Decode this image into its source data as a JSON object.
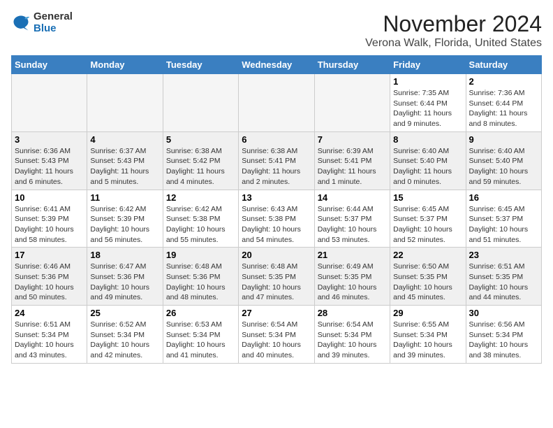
{
  "header": {
    "logo_general": "General",
    "logo_blue": "Blue",
    "month_title": "November 2024",
    "location": "Verona Walk, Florida, United States"
  },
  "weekdays": [
    "Sunday",
    "Monday",
    "Tuesday",
    "Wednesday",
    "Thursday",
    "Friday",
    "Saturday"
  ],
  "weeks": [
    [
      {
        "day": "",
        "info": "",
        "empty": true
      },
      {
        "day": "",
        "info": "",
        "empty": true
      },
      {
        "day": "",
        "info": "",
        "empty": true
      },
      {
        "day": "",
        "info": "",
        "empty": true
      },
      {
        "day": "",
        "info": "",
        "empty": true
      },
      {
        "day": "1",
        "info": "Sunrise: 7:35 AM\nSunset: 6:44 PM\nDaylight: 11 hours\nand 9 minutes.",
        "empty": false
      },
      {
        "day": "2",
        "info": "Sunrise: 7:36 AM\nSunset: 6:44 PM\nDaylight: 11 hours\nand 8 minutes.",
        "empty": false
      }
    ],
    [
      {
        "day": "3",
        "info": "Sunrise: 6:36 AM\nSunset: 5:43 PM\nDaylight: 11 hours\nand 6 minutes.",
        "empty": false
      },
      {
        "day": "4",
        "info": "Sunrise: 6:37 AM\nSunset: 5:43 PM\nDaylight: 11 hours\nand 5 minutes.",
        "empty": false
      },
      {
        "day": "5",
        "info": "Sunrise: 6:38 AM\nSunset: 5:42 PM\nDaylight: 11 hours\nand 4 minutes.",
        "empty": false
      },
      {
        "day": "6",
        "info": "Sunrise: 6:38 AM\nSunset: 5:41 PM\nDaylight: 11 hours\nand 2 minutes.",
        "empty": false
      },
      {
        "day": "7",
        "info": "Sunrise: 6:39 AM\nSunset: 5:41 PM\nDaylight: 11 hours\nand 1 minute.",
        "empty": false
      },
      {
        "day": "8",
        "info": "Sunrise: 6:40 AM\nSunset: 5:40 PM\nDaylight: 11 hours\nand 0 minutes.",
        "empty": false
      },
      {
        "day": "9",
        "info": "Sunrise: 6:40 AM\nSunset: 5:40 PM\nDaylight: 10 hours\nand 59 minutes.",
        "empty": false
      }
    ],
    [
      {
        "day": "10",
        "info": "Sunrise: 6:41 AM\nSunset: 5:39 PM\nDaylight: 10 hours\nand 58 minutes.",
        "empty": false
      },
      {
        "day": "11",
        "info": "Sunrise: 6:42 AM\nSunset: 5:39 PM\nDaylight: 10 hours\nand 56 minutes.",
        "empty": false
      },
      {
        "day": "12",
        "info": "Sunrise: 6:42 AM\nSunset: 5:38 PM\nDaylight: 10 hours\nand 55 minutes.",
        "empty": false
      },
      {
        "day": "13",
        "info": "Sunrise: 6:43 AM\nSunset: 5:38 PM\nDaylight: 10 hours\nand 54 minutes.",
        "empty": false
      },
      {
        "day": "14",
        "info": "Sunrise: 6:44 AM\nSunset: 5:37 PM\nDaylight: 10 hours\nand 53 minutes.",
        "empty": false
      },
      {
        "day": "15",
        "info": "Sunrise: 6:45 AM\nSunset: 5:37 PM\nDaylight: 10 hours\nand 52 minutes.",
        "empty": false
      },
      {
        "day": "16",
        "info": "Sunrise: 6:45 AM\nSunset: 5:37 PM\nDaylight: 10 hours\nand 51 minutes.",
        "empty": false
      }
    ],
    [
      {
        "day": "17",
        "info": "Sunrise: 6:46 AM\nSunset: 5:36 PM\nDaylight: 10 hours\nand 50 minutes.",
        "empty": false
      },
      {
        "day": "18",
        "info": "Sunrise: 6:47 AM\nSunset: 5:36 PM\nDaylight: 10 hours\nand 49 minutes.",
        "empty": false
      },
      {
        "day": "19",
        "info": "Sunrise: 6:48 AM\nSunset: 5:36 PM\nDaylight: 10 hours\nand 48 minutes.",
        "empty": false
      },
      {
        "day": "20",
        "info": "Sunrise: 6:48 AM\nSunset: 5:35 PM\nDaylight: 10 hours\nand 47 minutes.",
        "empty": false
      },
      {
        "day": "21",
        "info": "Sunrise: 6:49 AM\nSunset: 5:35 PM\nDaylight: 10 hours\nand 46 minutes.",
        "empty": false
      },
      {
        "day": "22",
        "info": "Sunrise: 6:50 AM\nSunset: 5:35 PM\nDaylight: 10 hours\nand 45 minutes.",
        "empty": false
      },
      {
        "day": "23",
        "info": "Sunrise: 6:51 AM\nSunset: 5:35 PM\nDaylight: 10 hours\nand 44 minutes.",
        "empty": false
      }
    ],
    [
      {
        "day": "24",
        "info": "Sunrise: 6:51 AM\nSunset: 5:34 PM\nDaylight: 10 hours\nand 43 minutes.",
        "empty": false
      },
      {
        "day": "25",
        "info": "Sunrise: 6:52 AM\nSunset: 5:34 PM\nDaylight: 10 hours\nand 42 minutes.",
        "empty": false
      },
      {
        "day": "26",
        "info": "Sunrise: 6:53 AM\nSunset: 5:34 PM\nDaylight: 10 hours\nand 41 minutes.",
        "empty": false
      },
      {
        "day": "27",
        "info": "Sunrise: 6:54 AM\nSunset: 5:34 PM\nDaylight: 10 hours\nand 40 minutes.",
        "empty": false
      },
      {
        "day": "28",
        "info": "Sunrise: 6:54 AM\nSunset: 5:34 PM\nDaylight: 10 hours\nand 39 minutes.",
        "empty": false
      },
      {
        "day": "29",
        "info": "Sunrise: 6:55 AM\nSunset: 5:34 PM\nDaylight: 10 hours\nand 39 minutes.",
        "empty": false
      },
      {
        "day": "30",
        "info": "Sunrise: 6:56 AM\nSunset: 5:34 PM\nDaylight: 10 hours\nand 38 minutes.",
        "empty": false
      }
    ]
  ]
}
